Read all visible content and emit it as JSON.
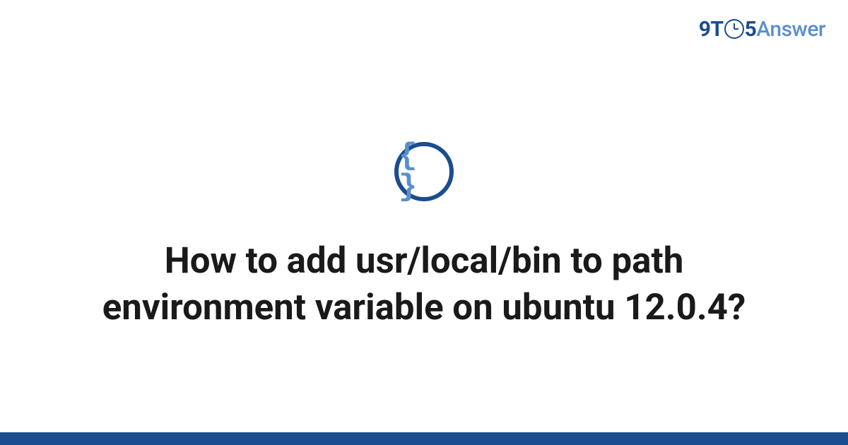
{
  "logo": {
    "prefix": "9T",
    "suffix_digit": "5",
    "suffix_word": "Answer"
  },
  "icon": {
    "symbol": "{ }"
  },
  "title": "How to add usr/local/bin to path environment variable on ubuntu 12.0.4?"
}
